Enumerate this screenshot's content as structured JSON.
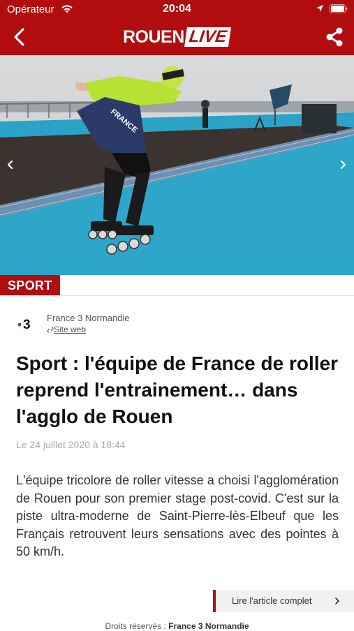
{
  "status_bar": {
    "carrier": "Opérateur",
    "time": "20:04"
  },
  "header": {
    "logo_main": "ROUEN",
    "logo_accent": "LIVE",
    "brand_color": "#b10d0f"
  },
  "photo": {
    "jersey_text": "FRANCE"
  },
  "article": {
    "category": "SPORT",
    "source_logo_text": "3",
    "source_name": "France 3 Normandie",
    "source_link": "Site web",
    "title": "Sport : l'équipe de France de roller reprend l'entrainement… dans l'agglo de Rouen",
    "date": "Le 24 juillet 2020 à 18:44",
    "body": "L'équipe tricolore de roller vitesse a choisi l'agglomération de Rouen pour son premier stage post-covid. C'est sur la piste ultra-moderne de Saint-Pierre-lès-Elbeuf que les Français retrouvent leurs sensations avec des pointes à 50 km/h.",
    "read_more": "Lire l'article complet",
    "rights_prefix": "Droits réservés :",
    "rights_owner": "France 3 Normandie"
  },
  "icons": [
    "wifi-icon",
    "location-arrow-icon",
    "battery-icon",
    "back-chevron-icon",
    "share-icon",
    "chevron-left-icon",
    "chevron-right-icon",
    "link-icon",
    "chevron-right-small-icon"
  ]
}
